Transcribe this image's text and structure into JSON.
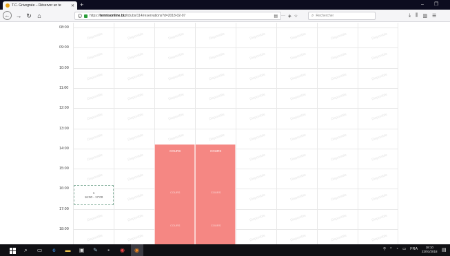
{
  "browser": {
    "tab_title": "T.C. Grivegnée – Réserver un te",
    "tab_close": "✕",
    "new_tab": "+",
    "url_prefix": "https://",
    "url_domain": "tennisonline.biz",
    "url_path": "/tclubs/114/reservations?d=2018-02-07",
    "search_placeholder": "Rechercher",
    "more_actions": "···"
  },
  "schedule": {
    "hours": [
      "08:00",
      "09:00",
      "10:00",
      "11:00",
      "12:00",
      "13:00",
      "14:00",
      "15:00",
      "16:00",
      "17:00",
      "18:00"
    ],
    "available_label": "Disponible",
    "cours_label": "COURS",
    "reservation": {
      "player": "1",
      "time": "16:00 - 17:00"
    }
  },
  "taskbar": {
    "lang": "FRA",
    "time": "18:10",
    "date": "22/01/2018"
  }
}
